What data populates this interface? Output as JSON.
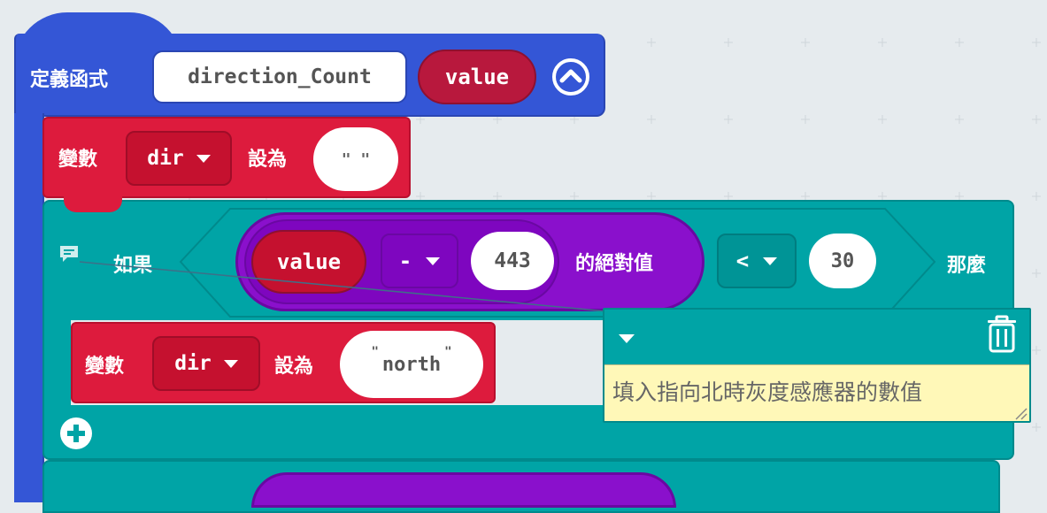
{
  "function_block": {
    "keyword": "定義函式",
    "name": "direction_Count",
    "param": "value"
  },
  "set_block_1": {
    "keyword": "變數",
    "variable": "dir",
    "to_label": "設為",
    "value": "\" \""
  },
  "if_block": {
    "if_label": "如果",
    "then_label": "那麼",
    "condition": {
      "left_var": "value",
      "operator": "-",
      "number": "443",
      "abs_label": "的絕對值",
      "compare_op": "<",
      "compare_num": "30"
    },
    "set_block": {
      "keyword": "變數",
      "variable": "dir",
      "to_label": "設為",
      "value": "north",
      "quote_open": "\"",
      "quote_close": "\""
    }
  },
  "comment": {
    "text": "填入指向北時灰度感應器的數值"
  },
  "colors": {
    "functions": "#3456d6",
    "variables": "#dd1b3d",
    "logic": "#00a4a6",
    "math": "#8a10cc",
    "comment_bg": "#fff8b8",
    "workspace": "#e6ebee"
  },
  "icons": [
    "collapse-icon",
    "comment-icon",
    "dropdown-icon",
    "trash-icon",
    "add-icon",
    "resize-icon"
  ]
}
